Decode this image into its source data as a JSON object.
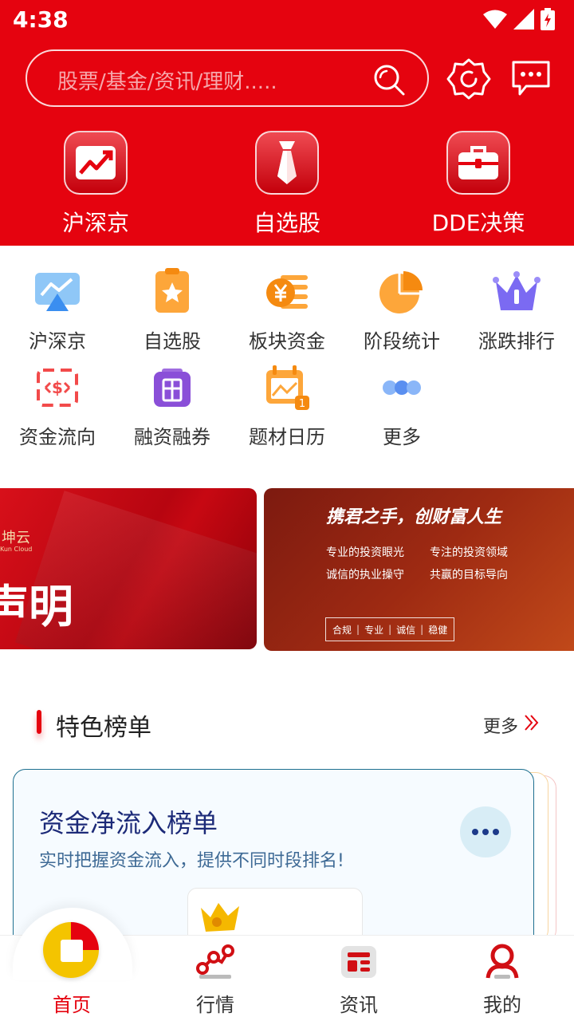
{
  "status": {
    "time": "4:38"
  },
  "search": {
    "placeholder": "股票/基金/资讯/理财....."
  },
  "top_nav": [
    {
      "label": "沪深京",
      "icon": "chart-up-icon"
    },
    {
      "label": "自选股",
      "icon": "tie-icon"
    },
    {
      "label": "DDE决策",
      "icon": "briefcase-icon"
    }
  ],
  "grid": [
    {
      "label": "沪深京",
      "icon": "line-chart-icon"
    },
    {
      "label": "自选股",
      "icon": "star-bookmark-icon"
    },
    {
      "label": "板块资金",
      "icon": "yen-coin-icon"
    },
    {
      "label": "阶段统计",
      "icon": "pie-chart-icon"
    },
    {
      "label": "涨跌排行",
      "icon": "crown-icon"
    },
    {
      "label": "资金流向",
      "icon": "money-flow-icon"
    },
    {
      "label": "融资融券",
      "icon": "margin-icon"
    },
    {
      "label": "题材日历",
      "icon": "calendar-icon"
    },
    {
      "label": "更多",
      "icon": "more-dots-icon"
    }
  ],
  "banners": {
    "left": {
      "brand": "坤云",
      "brand_en": "Kun Cloud",
      "title": "声明"
    },
    "right": {
      "title": "携君之手，创财富人生",
      "line1a": "专业的投资眼光",
      "line1b": "专注的投资领域",
      "line2a": "诚信的执业操守",
      "line2b": "共赢的目标导向",
      "tags": [
        "合规",
        "专业",
        "诚信",
        "稳健"
      ]
    }
  },
  "section": {
    "title": "特色榜单",
    "more": "更多"
  },
  "card": {
    "title": "资金净流入榜单",
    "subtitle": "实时把握资金流入，提供不同时段排名!"
  },
  "bottom_nav": [
    {
      "label": "首页",
      "active": true
    },
    {
      "label": "行情"
    },
    {
      "label": "资讯"
    },
    {
      "label": "我的"
    }
  ],
  "colors": {
    "brand_red": "#e5030f",
    "card_title": "#1c2a78"
  }
}
